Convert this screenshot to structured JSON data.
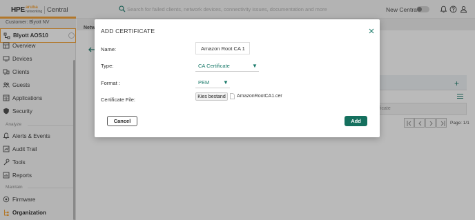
{
  "header": {
    "logo_hpe": "HPE",
    "logo_aruba_top": "aruba",
    "logo_aruba_bottom": "networking",
    "product": "Central",
    "search_placeholder": "Search for failed clients, network devices, connectivity issues, documentation and more",
    "new_central_label": "New Central",
    "icons": [
      "bell-icon",
      "help-icon",
      "user-icon"
    ]
  },
  "sidebar": {
    "customer": "Customer: Blyott NV",
    "site": "Blyott AOS10",
    "items": [
      {
        "label": "Overview",
        "icon": "overview-icon"
      },
      {
        "label": "Devices",
        "icon": "devices-icon"
      },
      {
        "label": "Clients",
        "icon": "clients-icon"
      },
      {
        "label": "Guests",
        "icon": "guests-icon"
      },
      {
        "label": "Applications",
        "icon": "applications-icon"
      },
      {
        "label": "Security",
        "icon": "security-icon"
      }
    ],
    "section_analyze": "Analyze",
    "analyze_items": [
      {
        "label": "Alerts & Events",
        "icon": "alerts-icon"
      },
      {
        "label": "Audit Trail",
        "icon": "audit-icon"
      },
      {
        "label": "Tools",
        "icon": "tools-icon"
      },
      {
        "label": "Reports",
        "icon": "reports-icon"
      }
    ],
    "section_maintain": "Maintain",
    "maintain_items": [
      {
        "label": "Firmware",
        "icon": "firmware-icon"
      },
      {
        "label": "Organization",
        "icon": "organization-icon",
        "active": true
      }
    ]
  },
  "background": {
    "breadcrumb": "Netw",
    "cell_text": "ficate",
    "page_text": "Page: 1/1"
  },
  "modal": {
    "title": "ADD CERTIFICATE",
    "name_label": "Name:",
    "name_value": "Amazon Root CA 1",
    "type_label": "Type:",
    "type_value": "CA Certificate",
    "format_label": "Format :",
    "format_value": "PEM",
    "file_label": "Certificate File:",
    "file_button": "Kies bestand",
    "file_name": "AmazonRootCA1.cer",
    "cancel_label": "Cancel",
    "add_label": "Add"
  },
  "colors": {
    "accent": "#f39c2b",
    "primary": "#15705e",
    "link": "#1a7a6a"
  }
}
